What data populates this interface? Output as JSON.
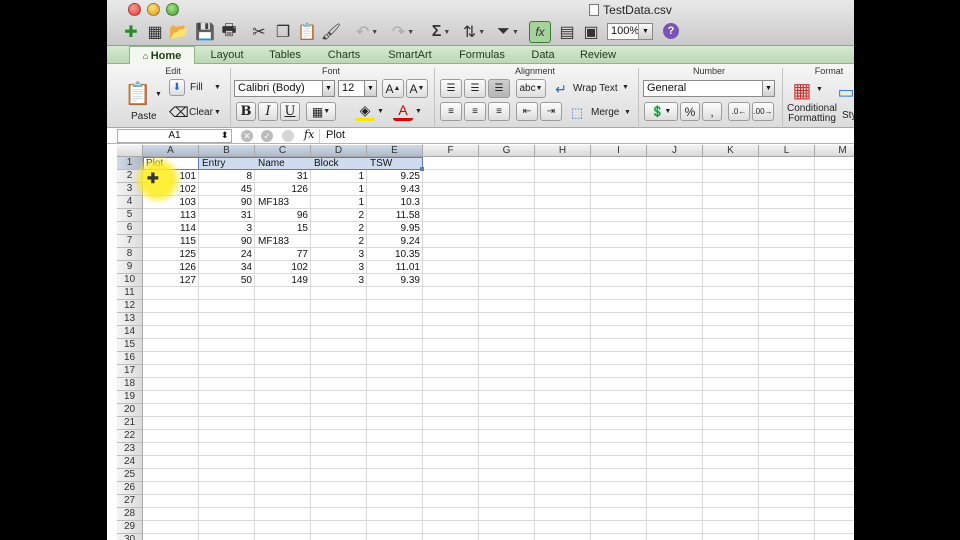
{
  "window": {
    "title": "TestData.csv"
  },
  "toolbar": {
    "zoom": "100%"
  },
  "ribbon_tabs": [
    {
      "label": "Home"
    },
    {
      "label": "Layout"
    },
    {
      "label": "Tables"
    },
    {
      "label": "Charts"
    },
    {
      "label": "SmartArt"
    },
    {
      "label": "Formulas"
    },
    {
      "label": "Data"
    },
    {
      "label": "Review"
    }
  ],
  "ribbon": {
    "groups": {
      "edit": "Edit",
      "font": "Font",
      "alignment": "Alignment",
      "number": "Number",
      "format": "Format"
    },
    "paste": "Paste",
    "fill": "Fill",
    "clear": "Clear",
    "font_name": "Calibri (Body)",
    "font_size": "12",
    "wrap_text": "Wrap Text",
    "merge": "Merge",
    "number_format": "General",
    "abc": "abc",
    "conditional_formatting_line1": "Conditional",
    "conditional_formatting_line2": "Formatting",
    "styles_partial": "Sty"
  },
  "formula_bar": {
    "name_box": "A1",
    "fx": "fx",
    "value": "Plot"
  },
  "columns": [
    "A",
    "B",
    "C",
    "D",
    "E",
    "F",
    "G",
    "H",
    "I",
    "J",
    "K",
    "L",
    "M"
  ],
  "rows": [
    "1",
    "2",
    "3",
    "4",
    "5",
    "6",
    "7",
    "8",
    "9",
    "10",
    "11",
    "12",
    "13",
    "14",
    "15",
    "16",
    "17",
    "18",
    "19",
    "20",
    "21",
    "22",
    "23",
    "24",
    "25",
    "26",
    "27",
    "28",
    "29",
    "30"
  ],
  "table": {
    "headers": [
      "Plot",
      "Entry",
      "Name",
      "Block",
      "TSW"
    ],
    "data": [
      [
        "101",
        "8",
        "31",
        "1",
        "9.25"
      ],
      [
        "102",
        "45",
        "126",
        "1",
        "9.43"
      ],
      [
        "103",
        "90",
        "MF183",
        "1",
        "10.3"
      ],
      [
        "113",
        "31",
        "96",
        "2",
        "11.58"
      ],
      [
        "114",
        "3",
        "15",
        "2",
        "9.95"
      ],
      [
        "115",
        "90",
        "MF183",
        "2",
        "9.24"
      ],
      [
        "125",
        "24",
        "77",
        "3",
        "10.35"
      ],
      [
        "126",
        "34",
        "102",
        "3",
        "11.01"
      ],
      [
        "127",
        "50",
        "149",
        "3",
        "9.39"
      ]
    ]
  },
  "colors": {
    "ribbon_tab_green": "#bcd8b5",
    "selection_blue": "#cfdcef",
    "cursor_highlight": "#ffeb1e"
  }
}
